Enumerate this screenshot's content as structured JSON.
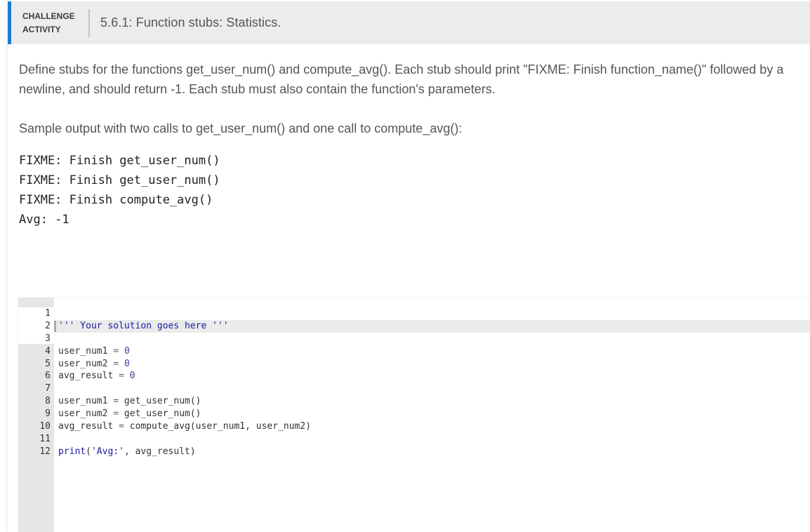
{
  "header": {
    "kind_line1": "CHALLENGE",
    "kind_line2": "ACTIVITY",
    "title": "5.6.1: Function stubs: Statistics.",
    "accent_color": "#1a7fd1"
  },
  "description": {
    "paragraph": "Define stubs for the functions get_user_num() and compute_avg(). Each stub should print \"FIXME: Finish function_name()\" followed by a newline, and should return -1. Each stub must also contain the function's parameters.",
    "sample_intro": "Sample output with two calls to get_user_num() and one call to compute_avg():"
  },
  "sample_output": [
    "FIXME: Finish get_user_num()",
    "FIXME: Finish get_user_num()",
    "FIXME: Finish compute_avg()",
    "Avg: -1"
  ],
  "editor": {
    "active_line": 2,
    "lines": [
      {
        "num": "1",
        "text": ""
      },
      {
        "num": "2",
        "text": "''' Your solution goes here '''"
      },
      {
        "num": "3",
        "text": ""
      },
      {
        "num": "4",
        "text": "user_num1 = 0"
      },
      {
        "num": "5",
        "text": "user_num2 = 0"
      },
      {
        "num": "6",
        "text": "avg_result = 0"
      },
      {
        "num": "7",
        "text": ""
      },
      {
        "num": "8",
        "text": "user_num1 = get_user_num()"
      },
      {
        "num": "9",
        "text": "user_num2 = get_user_num()"
      },
      {
        "num": "10",
        "text": "avg_result = compute_avg(user_num1, user_num2)"
      },
      {
        "num": "11",
        "text": ""
      },
      {
        "num": "12",
        "text": "print('Avg:', avg_result)"
      }
    ]
  }
}
